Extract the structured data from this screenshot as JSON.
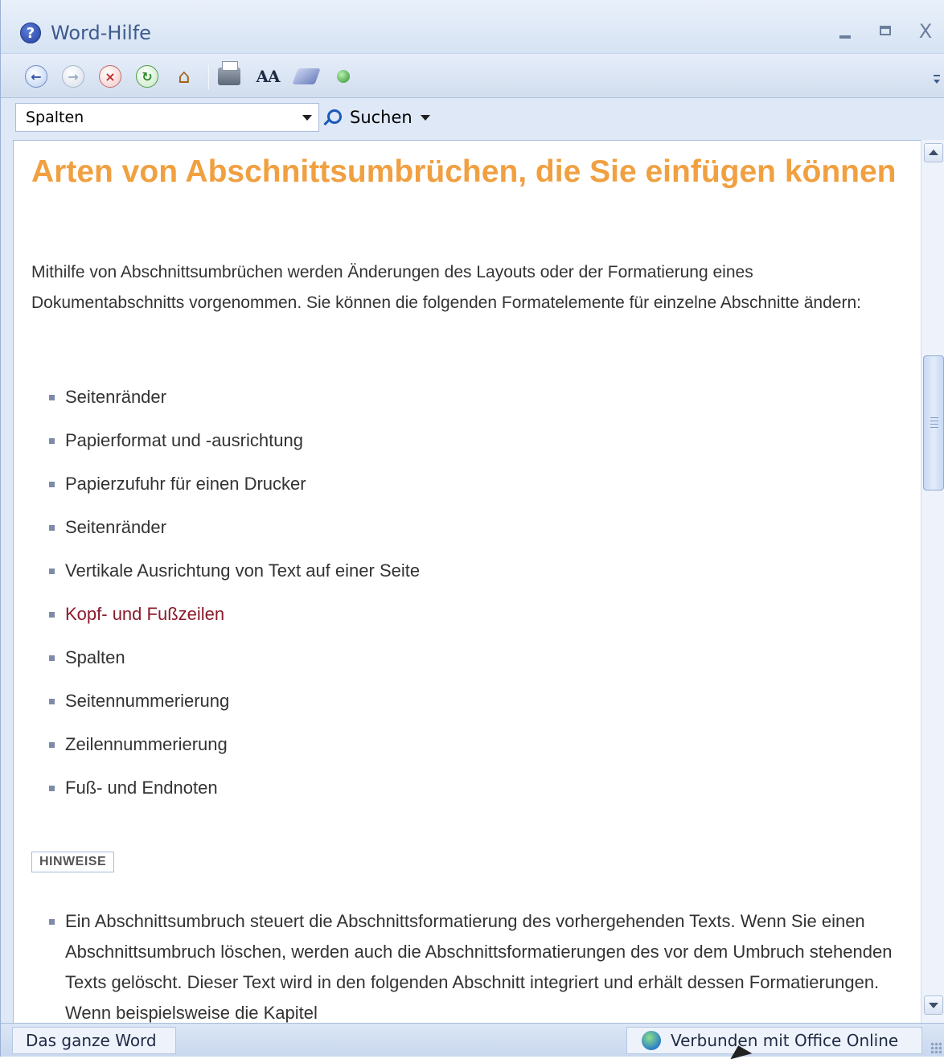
{
  "window": {
    "title": "Word-Hilfe",
    "icons": {
      "help": "help-circle-icon",
      "minimize": "minimize-icon",
      "maximize": "maximize-icon",
      "close": "close-icon"
    },
    "close_label": "X"
  },
  "toolbar": {
    "icons": [
      "back-icon",
      "forward-icon",
      "stop-icon",
      "refresh-icon",
      "home-icon",
      "print-icon",
      "text-size-icon",
      "table-of-contents-icon",
      "keep-on-top-icon"
    ],
    "labels": {
      "text_size": "AA"
    }
  },
  "search": {
    "value": "Spalten",
    "button_label": "Suchen"
  },
  "article": {
    "title": "Arten von Abschnittsumbrüchen, die Sie einfügen können",
    "intro": "Mithilfe von Abschnittsumbrüchen werden Änderungen des Layouts oder der Formatierung eines Dokumentabschnitts vorgenommen. Sie können die folgenden Formatelemente für einzelne Abschnitte ändern:",
    "items": [
      "Seitenränder",
      "Papierformat und -ausrichtung",
      "Papierzufuhr für einen Drucker",
      "Seitenränder",
      "Vertikale Ausrichtung von Text auf einer Seite",
      "Kopf- und Fußzeilen",
      "Spalten",
      "Seitennummerierung",
      "Zeilennummerierung",
      "Fuß- und Endnoten"
    ],
    "link_item_index": 5,
    "notes_label": "HINWEISE",
    "note": "Ein Abschnittsumbruch steuert die Abschnittsformatierung des vorhergehenden Texts. Wenn Sie einen Abschnittsumbruch löschen, werden auch die Abschnittsformatierungen des vor dem Umbruch stehenden Texts gelöscht. Dieser Text wird in den folgenden Abschnitt integriert und erhält dessen Formatierungen. Wenn beispielsweise die Kapitel"
  },
  "statusbar": {
    "scope": "Das ganze Word",
    "connection": "Verbunden mit Office Online",
    "connection_icon": "globe-icon"
  },
  "colors": {
    "heading": "#f0a041",
    "link": "#8a1c2b",
    "chrome": "#dfe8f6"
  }
}
